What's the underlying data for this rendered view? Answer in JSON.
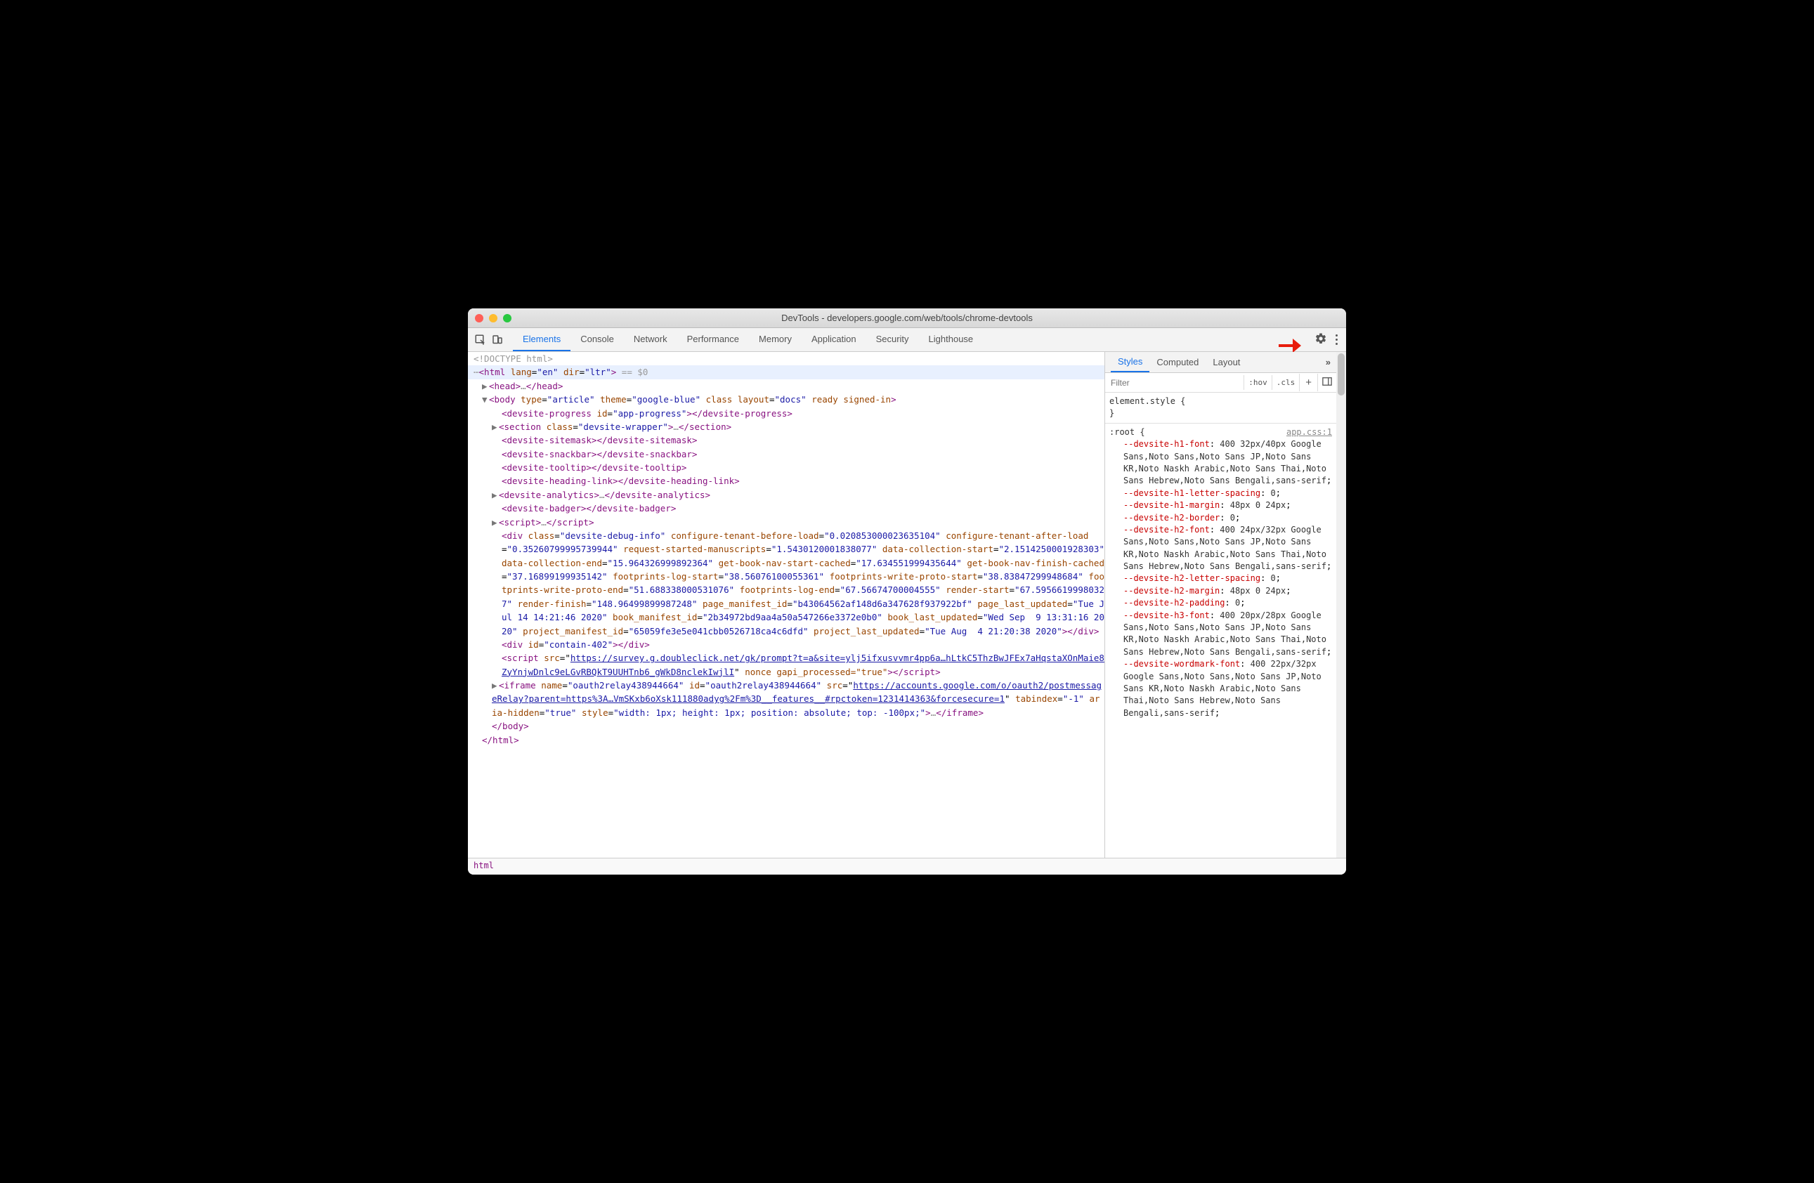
{
  "window": {
    "title": "DevTools - developers.google.com/web/tools/chrome-devtools"
  },
  "toolbar": {
    "tabs": [
      "Elements",
      "Console",
      "Network",
      "Performance",
      "Memory",
      "Application",
      "Security",
      "Lighthouse"
    ],
    "activeTab": "Elements"
  },
  "dom": {
    "doctype": "<!DOCTYPE html>",
    "highlight_suffix": " == $0",
    "html_open": {
      "lang": "en",
      "dir": "ltr"
    },
    "head": {
      "open": "<head>",
      "ellipsis": "…",
      "close": "</head>"
    },
    "body_open": {
      "type": "article",
      "theme": "google-blue",
      "class_attr": "class",
      "layout": "docs",
      "trailing": " ready signed-in"
    },
    "lines": {
      "progress_open": "<devsite-progress id=\"app-progress\">",
      "progress_close": "</devsite-progress>",
      "section_open": "<section class=\"devsite-wrapper\">",
      "section_ellipsis": "…",
      "section_close": "</section>",
      "sitemask": "<devsite-sitemask></devsite-sitemask>",
      "snackbar": "<devsite-snackbar></devsite-snackbar>",
      "tooltip": "<devsite-tooltip></devsite-tooltip>",
      "heading_link": "<devsite-heading-link></devsite-heading-link>",
      "analytics_open": "<devsite-analytics>",
      "analytics_ellipsis": "…",
      "analytics_close": "</devsite-analytics>",
      "badger": "<devsite-badger></devsite-badger>",
      "script1_open": "<script>",
      "script1_ellipsis": "…",
      "script1_close": "</script>"
    },
    "debug_div": {
      "class": "devsite-debug-info",
      "attrs": [
        {
          "n": "configure-tenant-before-load",
          "v": "0.020853000023635104"
        },
        {
          "n": "configure-tenant-after-load",
          "v": "0.35260799995739944"
        },
        {
          "n": "request-started-manuscripts",
          "v": "1.5430120001838077"
        },
        {
          "n": "data-collection-start",
          "v": "2.1514250001928303"
        },
        {
          "n": "data-collection-end",
          "v": "15.964326999892364"
        },
        {
          "n": "get-book-nav-start-cached",
          "v": "17.634551999435644"
        },
        {
          "n": "get-book-nav-finish-cached",
          "v": "37.16899199935142"
        },
        {
          "n": "footprints-log-start",
          "v": "38.56076100055361"
        },
        {
          "n": "footprints-write-proto-start",
          "v": "38.83847299948684"
        },
        {
          "n": "footprints-write-proto-end",
          "v": "51.688338000531076"
        },
        {
          "n": "footprints-log-end",
          "v": "67.56674700004555"
        },
        {
          "n": "render-start",
          "v": "67.59566199980327"
        },
        {
          "n": "render-finish",
          "v": "148.96499899987248"
        },
        {
          "n": "page_manifest_id",
          "v": "b43064562af148d6a347628f937922bf"
        },
        {
          "n": "page_last_updated",
          "v": "Tue Jul 14 14:21:46 2020"
        },
        {
          "n": "book_manifest_id",
          "v": "2b34972bd9aa4a50a547266e3372e0b0"
        },
        {
          "n": "book_last_updated",
          "v": "Wed Sep  9 13:31:16 2020"
        },
        {
          "n": "project_manifest_id",
          "v": "65059fe3e5e041cbb0526718ca4c6dfd"
        },
        {
          "n": "project_last_updated",
          "v": "Tue Aug  4 21:20:38 2020"
        }
      ]
    },
    "contain_div": {
      "id": "contain-402"
    },
    "survey_script": {
      "src": "https://survey.g.doubleclick.net/gk/prompt?t=a&site=ylj5ifxusvvmr4pp6a…hLtkC5ThzBwJFEx7aHqstaXOnMaie8ZyYnjwDnlc9eLGvRBQkT9UUHTnb6_gWkD8nclekIwjlI",
      "trailing": " nonce gapi_processed=\"true\""
    },
    "iframe": {
      "name": "oauth2relay438944664",
      "id": "oauth2relay438944664",
      "src": "https://accounts.google.com/o/oauth2/postmessageRelay?parent=https%3A…VmSKxb6oXsk111880adyg%2Fm%3D__features__#rpctoken=1231414363&forcesecure=1",
      "tabindex": "-1",
      "aria_hidden": "true",
      "style": "width: 1px; height: 1px; position: absolute; top: -100px;"
    },
    "body_close": "</body>",
    "html_close": "</html>",
    "breadcrumb": "html"
  },
  "styles": {
    "tabs": [
      "Styles",
      "Computed",
      "Layout"
    ],
    "activeTab": "Styles",
    "more": "»",
    "filter_placeholder": "Filter",
    "hov": ":hov",
    "cls": ".cls",
    "element_style": "element.style {",
    "element_style_close": "}",
    "root_selector": ":root {",
    "css_source": "app.css:1",
    "declarations": [
      {
        "prop": "--devsite-h1-font",
        "val": "400 32px/40px Google Sans,Noto Sans,Noto Sans JP,Noto Sans KR,Noto Naskh Arabic,Noto Sans Thai,Noto Sans Hebrew,Noto Sans Bengali,sans-serif"
      },
      {
        "prop": "--devsite-h1-letter-spacing",
        "val": "0"
      },
      {
        "prop": "--devsite-h1-margin",
        "val": "48px 0 24px"
      },
      {
        "prop": "--devsite-h2-border",
        "val": "0"
      },
      {
        "prop": "--devsite-h2-font",
        "val": "400 24px/32px Google Sans,Noto Sans,Noto Sans JP,Noto Sans KR,Noto Naskh Arabic,Noto Sans Thai,Noto Sans Hebrew,Noto Sans Bengali,sans-serif"
      },
      {
        "prop": "--devsite-h2-letter-spacing",
        "val": "0"
      },
      {
        "prop": "--devsite-h2-margin",
        "val": "48px 0 24px"
      },
      {
        "prop": "--devsite-h2-padding",
        "val": "0"
      },
      {
        "prop": "--devsite-h3-font",
        "val": "400 20px/28px Google Sans,Noto Sans,Noto Sans JP,Noto Sans KR,Noto Naskh Arabic,Noto Sans Thai,Noto Sans Hebrew,Noto Sans Bengali,sans-serif"
      },
      {
        "prop": "--devsite-wordmark-font",
        "val": "400 22px/32px Google Sans,Noto Sans,Noto Sans JP,Noto Sans KR,Noto Naskh Arabic,Noto Sans Thai,Noto Sans Hebrew,Noto Sans Bengali,sans-serif"
      }
    ]
  }
}
